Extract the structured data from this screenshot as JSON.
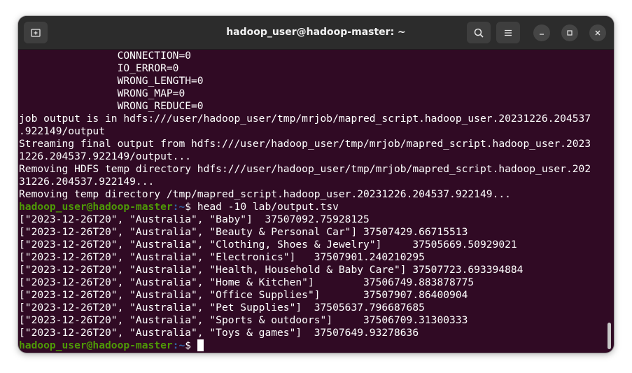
{
  "window": {
    "title": "hadoop_user@hadoop-master: ~"
  },
  "icons": {
    "new_tab": "new-tab-icon",
    "search": "search-icon",
    "menu": "hamburger-menu-icon",
    "minimize": "minimize-icon",
    "maximize": "maximize-icon",
    "close": "close-icon"
  },
  "terminal": {
    "output_lines": [
      "                CONNECTION=0",
      "                IO_ERROR=0",
      "                WRONG_LENGTH=0",
      "                WRONG_MAP=0",
      "                WRONG_REDUCE=0",
      "job output is in hdfs:///user/hadoop_user/tmp/mrjob/mapred_script.hadoop_user.20231226.204537",
      ".922149/output",
      "Streaming final output from hdfs:///user/hadoop_user/tmp/mrjob/mapred_script.hadoop_user.2023",
      "1226.204537.922149/output...",
      "Removing HDFS temp directory hdfs:///user/hadoop_user/tmp/mrjob/mapred_script.hadoop_user.202",
      "31226.204537.922149...",
      "Removing temp directory /tmp/mapred_script.hadoop_user.20231226.204537.922149..."
    ],
    "prompt_user": "hadoop_user@hadoop-master",
    "prompt_path": ":~",
    "prompt_symbol": "$ ",
    "command": "head -10 lab/output.tsv",
    "result_lines": [
      "[\"2023-12-26T20\", \"Australia\", \"Baby\"]  37507092.75928125",
      "[\"2023-12-26T20\", \"Australia\", \"Beauty & Personal Car\"] 37507429.66715513",
      "[\"2023-12-26T20\", \"Australia\", \"Clothing, Shoes & Jewelry\"]     37505669.50929021",
      "[\"2023-12-26T20\", \"Australia\", \"Electronics\"]   37507901.240210295",
      "[\"2023-12-26T20\", \"Australia\", \"Health, Household & Baby Care\"] 37507723.693394884",
      "[\"2023-12-26T20\", \"Australia\", \"Home & Kitchen\"]        37506749.883878775",
      "[\"2023-12-26T20\", \"Australia\", \"Office Supplies\"]       37507907.86400904",
      "[\"2023-12-26T20\", \"Australia\", \"Pet Supplies\"]  37505637.796687685",
      "[\"2023-12-26T20\", \"Australia\", \"Sports & outdoors\"]     37506709.31300333",
      "[\"2023-12-26T20\", \"Australia\", \"Toys & games\"]  37507649.93278636"
    ]
  },
  "colors": {
    "terminal_background": "#300a24",
    "titlebar_background": "#2c2c2c",
    "prompt_user": "#4e9a06",
    "prompt_path": "#3465a4",
    "text": "#ffffff"
  }
}
